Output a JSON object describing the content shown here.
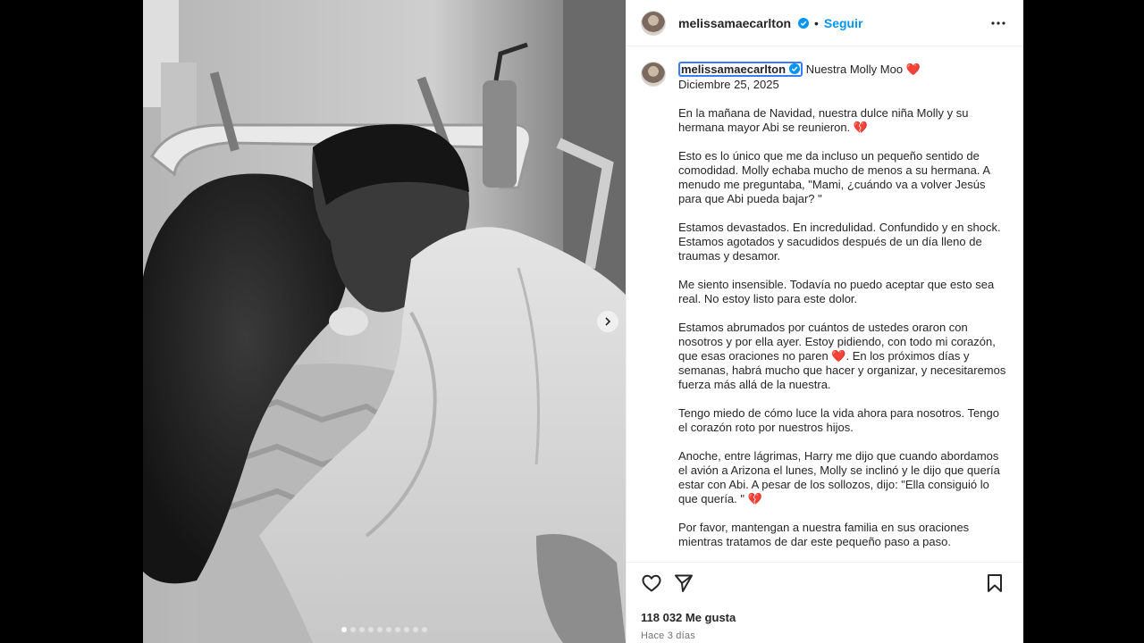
{
  "post": {
    "username": "melissamaecarlton",
    "follow_label": "Seguir",
    "separator": "•",
    "caption_title": "Nuestra Molly Moo",
    "caption_title_emoji": "❤️",
    "date": "Diciembre 25, 2025",
    "paragraphs": [
      {
        "text": "En la mañana de Navidad, nuestra dulce niña Molly y su hermana mayor Abi se reunieron. ",
        "emoji": "💔"
      },
      {
        "text": "Esto es lo único que me da incluso un pequeño sentido de comodidad. Molly echaba mucho de menos a su hermana. A menudo me preguntaba, \"Mami, ¿cuándo va a volver Jesús para que Abi pueda bajar? \"",
        "emoji": ""
      },
      {
        "text": "Estamos devastados. En incredulidad. Confundido y en shock. Estamos agotados y sacudidos después de un día lleno de traumas y desamor.",
        "emoji": ""
      },
      {
        "text": "Me siento insensible. Todavía no puedo aceptar que esto sea real. No estoy listo para este dolor.",
        "emoji": ""
      },
      {
        "text": "Estamos abrumados por cuántos de ustedes oraron con nosotros y por ella ayer. Estoy pidiendo, con todo mi corazón, que esas oraciones no paren ",
        "emoji": "❤️",
        "after": ". En los próximos días y semanas, habrá mucho que hacer y organizar, y necesitaremos fuerza más allá de la nuestra."
      },
      {
        "text": "Tengo miedo de cómo luce la vida ahora para nosotros. Tengo el corazón roto por nuestros hijos.",
        "emoji": ""
      },
      {
        "text": "Anoche, entre lágrimas, Harry me dijo que cuando abordamos el avión a Arizona el lunes, Molly se inclinó y le dijo que quería estar con Abi. A pesar de los sollozos, dijo: \"Ella consiguió lo que quería. \" ",
        "emoji": "💔"
      },
      {
        "text": "Por favor, mantengan a nuestra familia en sus oraciones mientras tratamos de dar este pequeño paso a paso.",
        "emoji": ""
      }
    ],
    "likes": "118 032 Me gusta",
    "time_ago": "Hace 3 días"
  },
  "icons": {
    "verified": "verified-badge-icon",
    "more": "more-options-icon",
    "like": "heart-icon",
    "share": "send-icon",
    "save": "bookmark-icon",
    "next": "chevron-right-icon"
  },
  "carousel": {
    "slides": 10,
    "active_index": 0
  },
  "colors": {
    "accent": "#0095f6",
    "verified": "#0095f6",
    "heart": "#e0245e"
  }
}
